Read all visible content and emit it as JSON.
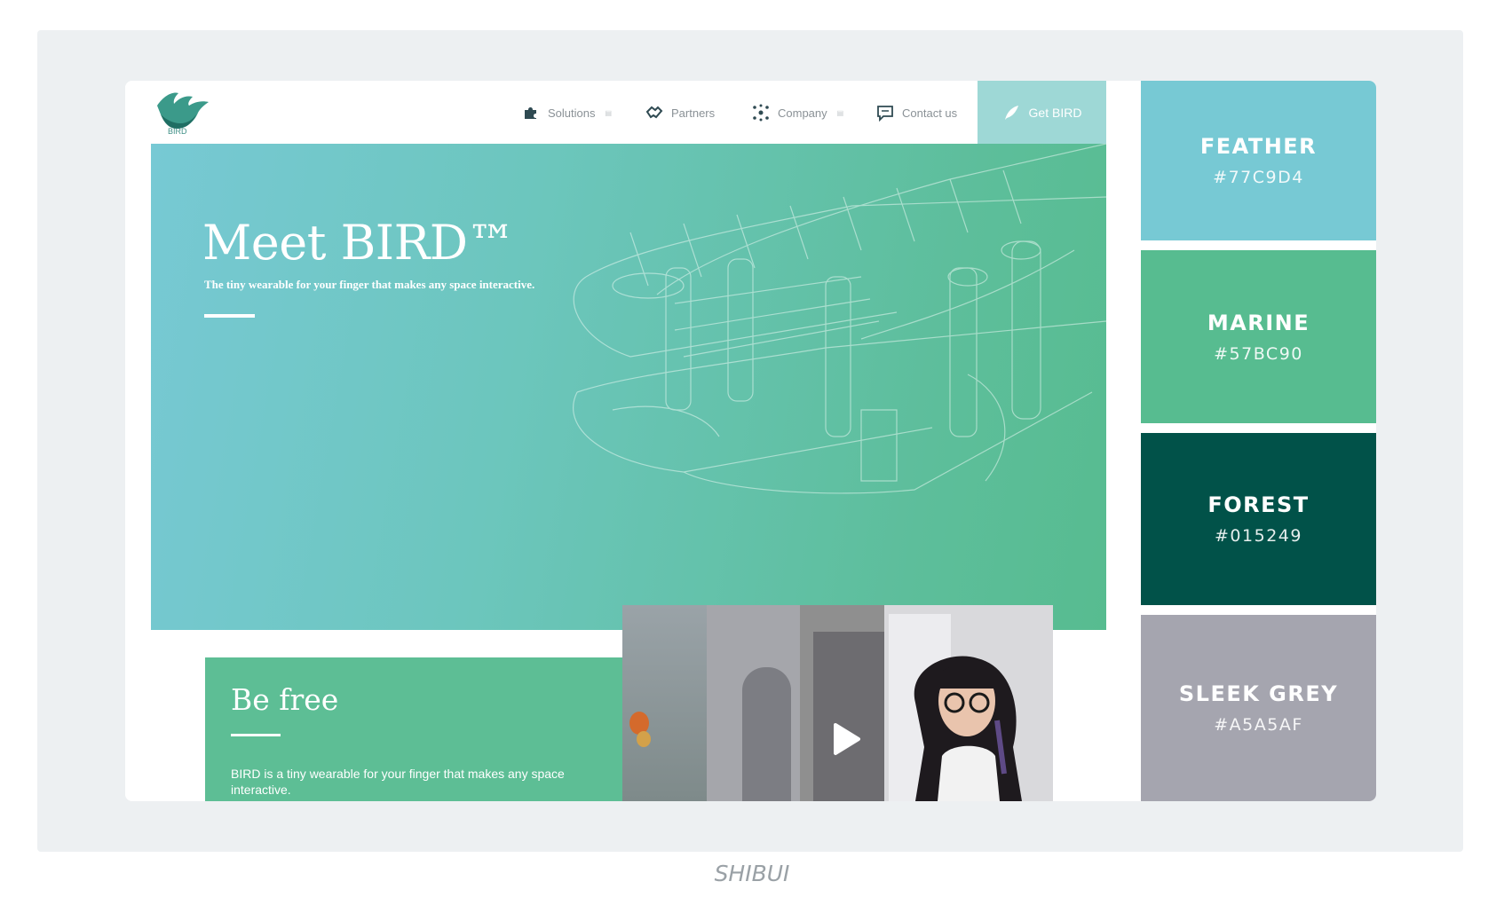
{
  "site": {
    "logo_text": "BIRD",
    "nav": [
      {
        "label": "Solutions",
        "icon": "puzzle-icon",
        "has_caret": true
      },
      {
        "label": "Partners",
        "icon": "handshake-icon",
        "has_caret": false
      },
      {
        "label": "Company",
        "icon": "network-icon",
        "has_caret": true
      },
      {
        "label": "Contact us",
        "icon": "chat-icon",
        "has_caret": false
      }
    ],
    "cta_label": "Get BIRD",
    "hero": {
      "title": "Meet BIRD™",
      "subtitle": "The tiny wearable for your finger that makes any space interactive."
    },
    "feature": {
      "title": "Be free",
      "text": "BIRD is a tiny wearable for your finger that makes any space interactive."
    },
    "video": {
      "icon": "play-icon"
    }
  },
  "palette": [
    {
      "name": "FEATHER",
      "hex": "#77C9D4",
      "color": "#77C9D4"
    },
    {
      "name": "MARINE",
      "hex": "#57BC90",
      "color": "#57BC90"
    },
    {
      "name": "FOREST",
      "hex": "#015249",
      "color": "#015249"
    },
    {
      "name": "SLEEK GREY",
      "hex": "#A5A5AF",
      "color": "#A5A5AF"
    }
  ],
  "caption": "SHIBUI"
}
